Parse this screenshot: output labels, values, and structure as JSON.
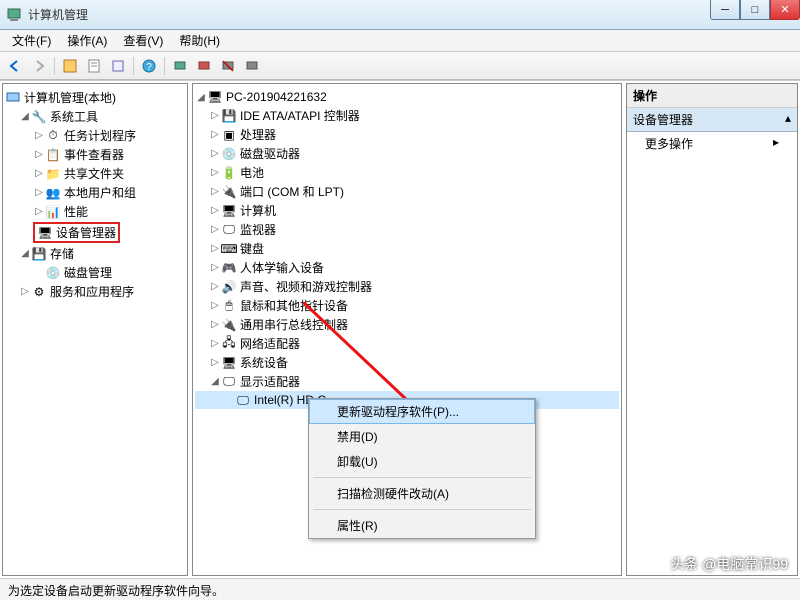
{
  "window": {
    "title": "计算机管理"
  },
  "menubar": [
    "文件(F)",
    "操作(A)",
    "查看(V)",
    "帮助(H)"
  ],
  "left_tree": {
    "root": "计算机管理(本地)",
    "groups": [
      {
        "label": "系统工具",
        "children": [
          "任务计划程序",
          "事件查看器",
          "共享文件夹",
          "本地用户和组",
          "性能",
          "设备管理器"
        ],
        "highlight_index": 5
      },
      {
        "label": "存储",
        "children": [
          "磁盘管理"
        ]
      },
      {
        "label": "服务和应用程序",
        "children": []
      }
    ]
  },
  "device_tree": {
    "root": "PC-201904221632",
    "categories": [
      "IDE ATA/ATAPI 控制器",
      "处理器",
      "磁盘驱动器",
      "电池",
      "端口 (COM 和 LPT)",
      "计算机",
      "监视器",
      "键盘",
      "人体学输入设备",
      "声音、视频和游戏控制器",
      "鼠标和其他指针设备",
      "通用串行总线控制器",
      "网络适配器",
      "系统设备",
      "显示适配器"
    ],
    "expanded_item": "Intel(R) HD G"
  },
  "context_menu": [
    "更新驱动程序软件(P)...",
    "禁用(D)",
    "卸载(U)",
    "—",
    "扫描检测硬件改动(A)",
    "—",
    "属性(R)"
  ],
  "right_panel": {
    "header": "操作",
    "section": "设备管理器",
    "item": "更多操作"
  },
  "status": "为选定设备启动更新驱动程序软件向导。",
  "watermark": "头条 @电脑常识99"
}
